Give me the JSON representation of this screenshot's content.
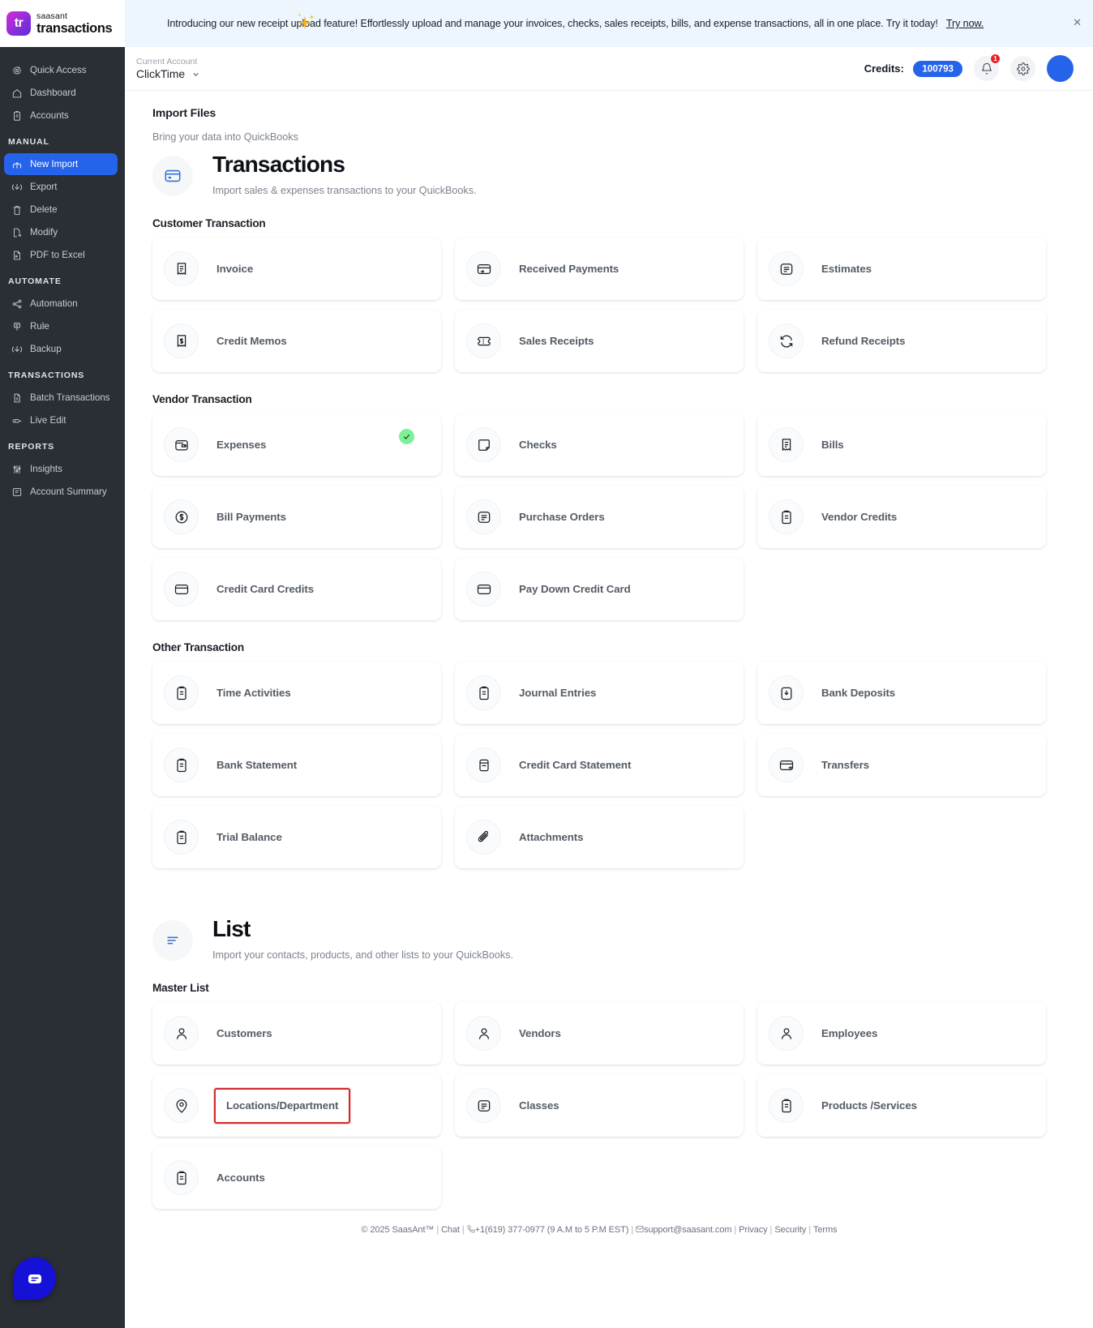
{
  "brand": {
    "top": "saasant",
    "bottom": "transactions",
    "logo_text": "tr"
  },
  "sidebar": {
    "groups": [
      {
        "label": "",
        "items": [
          {
            "label": "Quick Access",
            "icon": "target-icon",
            "active": false
          },
          {
            "label": "Dashboard",
            "icon": "home-icon",
            "active": false
          },
          {
            "label": "Accounts",
            "icon": "clipboard-icon",
            "active": false
          }
        ]
      },
      {
        "label": "MANUAL",
        "items": [
          {
            "label": "New Import",
            "icon": "upload-icon",
            "active": true
          },
          {
            "label": "Export",
            "icon": "download-icon",
            "active": false
          },
          {
            "label": "Delete",
            "icon": "trash-icon",
            "active": false
          },
          {
            "label": "Modify",
            "icon": "file-edit-icon",
            "active": false
          },
          {
            "label": "PDF to Excel",
            "icon": "pdf-icon",
            "active": false
          }
        ]
      },
      {
        "label": "AUTOMATE",
        "items": [
          {
            "label": "Automation",
            "icon": "share-nodes-icon",
            "active": false
          },
          {
            "label": "Rule",
            "icon": "rule-icon",
            "active": false
          },
          {
            "label": "Backup",
            "icon": "backup-icon",
            "active": false
          }
        ]
      },
      {
        "label": "TRANSACTIONS",
        "items": [
          {
            "label": "Batch Transactions",
            "icon": "document-icon",
            "active": false
          },
          {
            "label": "Live Edit",
            "icon": "pencil-line-icon",
            "active": false
          }
        ]
      },
      {
        "label": "REPORTS",
        "items": [
          {
            "label": "Insights",
            "icon": "sliders-icon",
            "active": false
          },
          {
            "label": "Account Summary",
            "icon": "summary-icon",
            "active": false
          }
        ]
      }
    ]
  },
  "banner": {
    "text": "Introducing our new receipt upload feature! Effortlessly upload and manage your invoices, checks, sales receipts, bills, and expense transactions, all in one place. Try it today!",
    "link": "Try now.",
    "close": "✕"
  },
  "topbar": {
    "account_label": "Current Account",
    "account_name": "ClickTime",
    "credits_label": "Credits:",
    "credits_value": "100793",
    "notification_count": "1"
  },
  "page": {
    "import_heading": "Import Files",
    "import_subheading": "Bring your data into QuickBooks"
  },
  "transactions_section": {
    "title": "Transactions",
    "desc": "Import sales & expenses transactions to your QuickBooks.",
    "icon": "credit-card-icon",
    "groups": [
      {
        "title": "Customer Transaction",
        "cards": [
          {
            "label": "Invoice",
            "icon": "invoice-icon"
          },
          {
            "label": "Received Payments",
            "icon": "received-payments-icon"
          },
          {
            "label": "Estimates",
            "icon": "estimates-icon"
          },
          {
            "label": "Credit Memos",
            "icon": "credit-memo-icon"
          },
          {
            "label": "Sales Receipts",
            "icon": "sales-receipt-icon"
          },
          {
            "label": "Refund Receipts",
            "icon": "refund-icon"
          }
        ]
      },
      {
        "title": "Vendor Transaction",
        "cards": [
          {
            "label": "Expenses",
            "icon": "wallet-icon",
            "checked": true
          },
          {
            "label": "Checks",
            "icon": "check-icon"
          },
          {
            "label": "Bills",
            "icon": "bill-icon"
          },
          {
            "label": "Bill Payments",
            "icon": "dollar-circle-icon"
          },
          {
            "label": "Purchase Orders",
            "icon": "purchase-order-icon"
          },
          {
            "label": "Vendor Credits",
            "icon": "vendor-credit-icon"
          },
          {
            "label": "Credit Card Credits",
            "icon": "credit-card-icon"
          },
          {
            "label": "Pay Down Credit Card",
            "icon": "credit-card-icon"
          },
          {
            "label": "",
            "icon": "",
            "placeholder": true
          }
        ]
      },
      {
        "title": "Other Transaction",
        "cards": [
          {
            "label": "Time Activities",
            "icon": "clipboard-icon"
          },
          {
            "label": "Journal Entries",
            "icon": "clipboard-icon"
          },
          {
            "label": "Bank Deposits",
            "icon": "bank-deposit-icon"
          },
          {
            "label": "Bank Statement",
            "icon": "clipboard-icon"
          },
          {
            "label": "Credit Card Statement",
            "icon": "card-statement-icon"
          },
          {
            "label": "Transfers",
            "icon": "transfer-icon"
          },
          {
            "label": "Trial Balance",
            "icon": "clipboard-icon"
          },
          {
            "label": "Attachments",
            "icon": "paperclip-icon"
          },
          {
            "label": "",
            "icon": "",
            "placeholder": true
          }
        ]
      }
    ]
  },
  "list_section": {
    "title": "List",
    "desc": "Import your contacts, products, and other lists to your QuickBooks.",
    "icon": "list-icon",
    "groups": [
      {
        "title": "Master List",
        "cards": [
          {
            "label": "Customers",
            "icon": "person-icon"
          },
          {
            "label": "Vendors",
            "icon": "person-icon"
          },
          {
            "label": "Employees",
            "icon": "person-icon"
          },
          {
            "label": "Locations/Department",
            "icon": "map-pin-icon",
            "highlighted": true
          },
          {
            "label": "Classes",
            "icon": "classes-icon"
          },
          {
            "label": "Products /Services",
            "icon": "products-icon"
          },
          {
            "label": "Accounts",
            "icon": "clipboard-icon"
          },
          {
            "label": "",
            "icon": "",
            "placeholder": true
          },
          {
            "label": "",
            "icon": "",
            "placeholder": true
          }
        ]
      }
    ]
  },
  "footer": {
    "copyright": "© 2025 SaasAnt™",
    "chat": "Chat",
    "phone": "+1(619) 377-0977 (9 A.M to 5 P.M EST)",
    "email": "support@saasant.com",
    "privacy": "Privacy",
    "security": "Security",
    "terms": "Terms"
  },
  "colors": {
    "accent": "#2563eb",
    "banner_bg": "#edf5fd",
    "sidebar_bg": "#2a2e35",
    "highlight": "#d62828",
    "check": "#7ff09a"
  }
}
